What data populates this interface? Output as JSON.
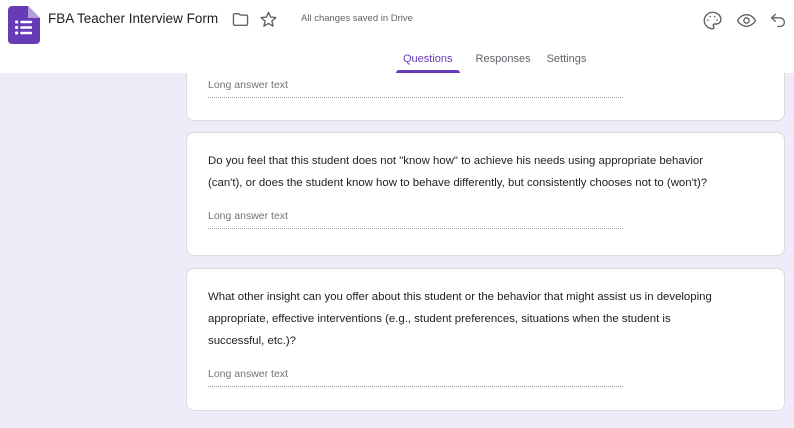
{
  "header": {
    "title": "FBA Teacher Interview Form",
    "saved_status": "All changes saved in Drive",
    "icons": {
      "logo": "google-forms-logo",
      "folder": "move-to-folder-icon",
      "star": "star-icon",
      "palette": "customize-theme-icon",
      "eye": "preview-icon",
      "undo": "undo-icon"
    }
  },
  "tabs": [
    {
      "label": "Questions",
      "active": true
    },
    {
      "label": "Responses",
      "active": false
    },
    {
      "label": "Settings",
      "active": false
    }
  ],
  "cards": [
    {
      "question": "",
      "placeholder": "Long answer text"
    },
    {
      "question": "Do you feel that this student does not \"know how\" to achieve his needs using appropriate behavior\n(can't), or does the student know how to behave differently, but consistently chooses not to (won't)?",
      "placeholder": "Long answer text"
    },
    {
      "question": "What other insight can you offer about this student or the behavior that might assist us in developing\nappropriate, effective interventions (e.g., student preferences, situations when the student is\nsuccessful, etc.)?",
      "placeholder": "Long answer text"
    }
  ],
  "colors": {
    "accent": "#673ab7",
    "logo_fold": "#b39ddb",
    "canvas_background": "#f0ebf8",
    "icon_gray": "#5f6368",
    "text_primary": "#202124",
    "placeholder_gray": "#70757a"
  }
}
